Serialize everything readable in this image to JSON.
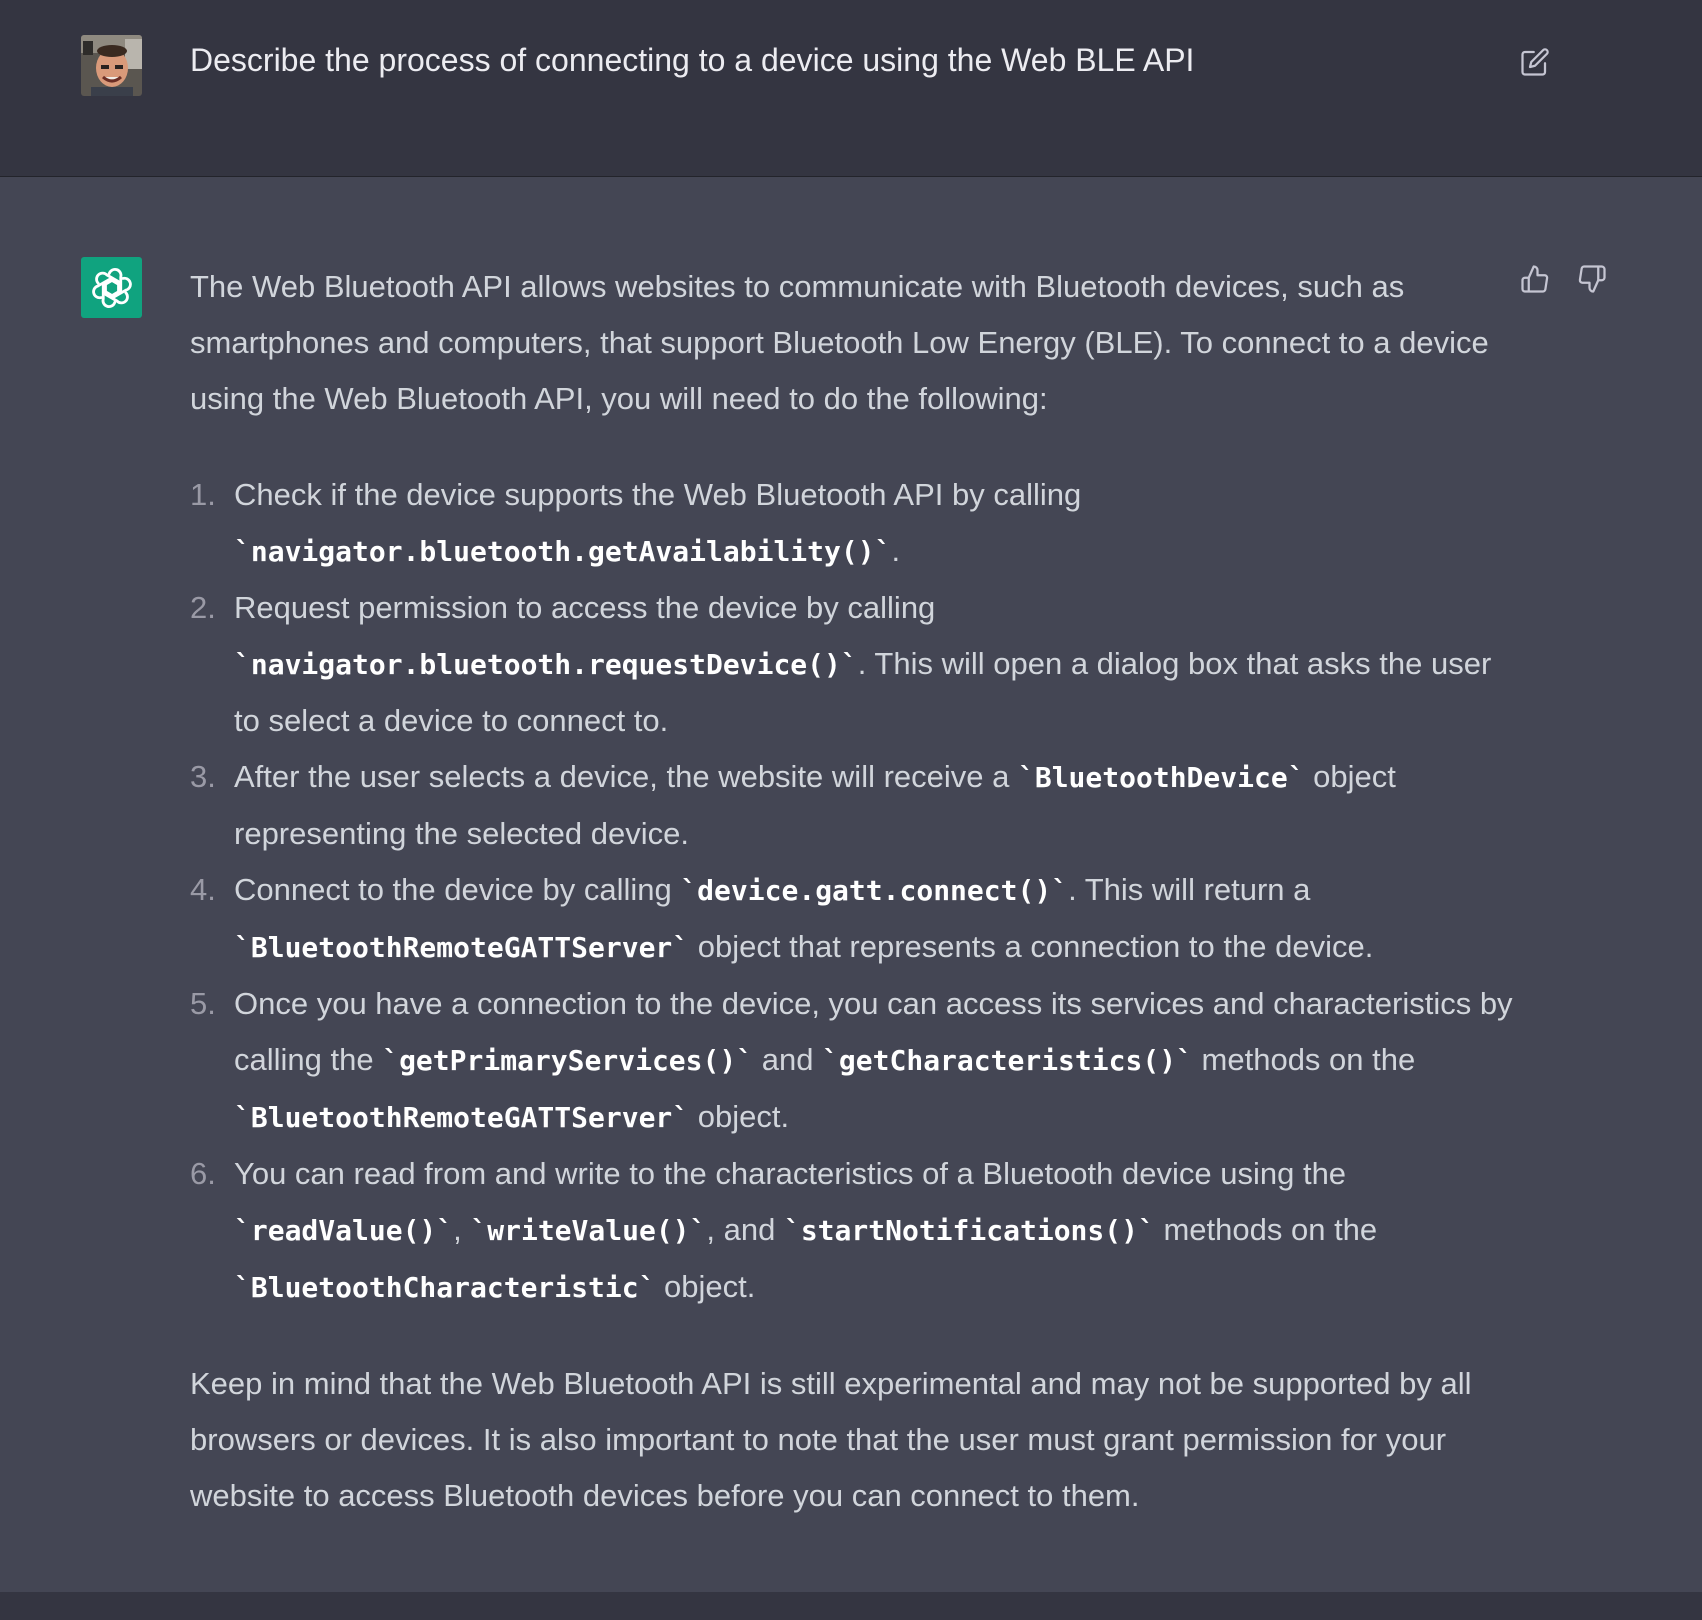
{
  "user_message": {
    "avatar": "user-photo",
    "text": "Describe the process of connecting to a device using the Web BLE API",
    "edit_icon": "edit-icon"
  },
  "assistant_message": {
    "avatar": "openai-logo-icon",
    "feedback": {
      "up_icon": "thumbs-up-icon",
      "down_icon": "thumbs-down-icon"
    },
    "intro": "The Web Bluetooth API allows websites to communicate with Bluetooth devices, such as smartphones and computers, that support Bluetooth Low Energy (BLE). To connect to a device using the Web Bluetooth API, you will need to do the following:",
    "steps": [
      [
        {
          "t": "Check if the device supports the Web Bluetooth API by calling "
        },
        {
          "code": "`navigator.bluetooth.getAvailability()`"
        },
        {
          "t": "."
        }
      ],
      [
        {
          "t": "Request permission to access the device by calling "
        },
        {
          "code": "`navigator.bluetooth.requestDevice()`"
        },
        {
          "t": ". This will open a dialog box that asks the user to select a device to connect to."
        }
      ],
      [
        {
          "t": "After the user selects a device, the website will receive a "
        },
        {
          "code": "`BluetoothDevice`"
        },
        {
          "t": " object representing the selected device."
        }
      ],
      [
        {
          "t": "Connect to the device by calling "
        },
        {
          "code": "`device.gatt.connect()`"
        },
        {
          "t": ". This will return a "
        },
        {
          "code": "`BluetoothRemoteGATTServer`"
        },
        {
          "t": " object that represents a connection to the device."
        }
      ],
      [
        {
          "t": "Once you have a connection to the device, you can access its services and characteristics by calling the "
        },
        {
          "code": "`getPrimaryServices()`"
        },
        {
          "t": " and "
        },
        {
          "code": "`getCharacteristics()`"
        },
        {
          "t": " methods on the "
        },
        {
          "code": "`BluetoothRemoteGATTServer`"
        },
        {
          "t": " object."
        }
      ],
      [
        {
          "t": "You can read from and write to the characteristics of a Bluetooth device using the "
        },
        {
          "code": "`readValue()`"
        },
        {
          "t": ", "
        },
        {
          "code": "`writeValue()`"
        },
        {
          "t": ", and "
        },
        {
          "code": "`startNotifications()`"
        },
        {
          "t": " methods on the "
        },
        {
          "code": "`BluetoothCharacteristic`"
        },
        {
          "t": " object."
        }
      ]
    ],
    "outro": "Keep in mind that the Web Bluetooth API is still experimental and may not be supported by all browsers or devices. It is also important to note that the user must grant permission for your website to access Bluetooth devices before you can connect to them."
  },
  "colors": {
    "background": "#343541",
    "assistant_background": "#444654",
    "text": "#d1d5db",
    "user_text": "#ececf1",
    "accent": "#10a37f"
  }
}
